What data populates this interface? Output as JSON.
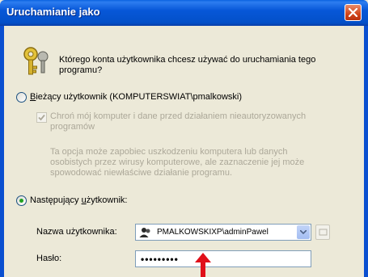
{
  "window": {
    "title": "Uruchamianie jako"
  },
  "question": "Którego konta użytkownika chcesz używać do uruchamiania tego programu?",
  "current_user": {
    "access_key": "B",
    "label_rest": "ieżący użytkownik (KOMPUTERSWIAT\\pmalkowski)",
    "selected": false,
    "protect_checkbox_label": "Chroń mój komputer i dane przed działaniem nieautoryzowanych programów",
    "protect_checked": true,
    "info_text": "Ta opcja może zapobiec uszkodzeniu komputera lub danych osobistych przez wirusy komputerowe, ale zaznaczenie jej może spowodować niewłaściwe działanie programu."
  },
  "other_user": {
    "label_start": "Następujący ",
    "access_key": "u",
    "label_rest": "żytkownik:",
    "selected": true
  },
  "fields": {
    "username_label": "Nazwa użytkownika:",
    "username_value": "PMALKOWSKIXP\\adminPawel",
    "password_label": "Hasło:",
    "password_value": "•••••••••"
  },
  "colors": {
    "arrow": "#e0101a",
    "title_bar": "#0757d8"
  }
}
